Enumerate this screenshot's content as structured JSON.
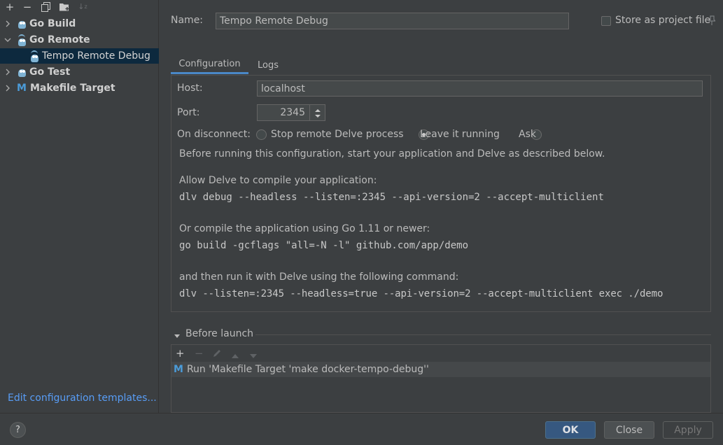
{
  "toolbar": {
    "icons": [
      "add-icon",
      "remove-icon",
      "copy-icon",
      "folder-add-icon",
      "sort-icon"
    ]
  },
  "tree": {
    "items": [
      {
        "label": "Go Build",
        "icon": "go-gopher-icon",
        "expanded": false
      },
      {
        "label": "Go Remote",
        "icon": "go-remote-icon",
        "expanded": true
      },
      {
        "label": "Tempo Remote Debug",
        "icon": "go-remote-icon",
        "selected": true
      },
      {
        "label": "Go Test",
        "icon": "go-gopher-icon",
        "expanded": false
      },
      {
        "label": "Makefile Target",
        "icon": "makefile-icon",
        "expanded": false
      }
    ]
  },
  "edit_templates_link": "Edit configuration templates...",
  "form": {
    "name_label": "Name:",
    "name_value": "Tempo Remote Debug",
    "store_label": "Store as project file",
    "tabs": [
      "Configuration",
      "Logs"
    ],
    "host_label": "Host:",
    "host_value": "localhost",
    "port_label": "Port:",
    "port_value": "2345",
    "disconnect_label": "On disconnect:",
    "disconnect_options": [
      "Stop remote Delve process",
      "Leave it running",
      "Ask"
    ],
    "disconnect_selected": "Leave it running"
  },
  "instructions": {
    "intro": "Before running this configuration, start your application and Delve as described below.",
    "step1_text": "Allow Delve to compile your application:",
    "step1_cmd": "dlv debug --headless --listen=:2345 --api-version=2 --accept-multiclient",
    "step2_text": "Or compile the application using Go 1.11 or newer:",
    "step2_cmd": "go build -gcflags \"all=-N -l\" github.com/app/demo",
    "step3_text": "and then run it with Delve using the following command:",
    "step3_cmd": "dlv --listen=:2345 --headless=true --api-version=2 --accept-multiclient exec ./demo"
  },
  "before_launch": {
    "title": "Before launch",
    "item": "Run 'Makefile Target 'make docker-tempo-debug''"
  },
  "buttons": {
    "help": "?",
    "ok": "OK",
    "close": "Close",
    "apply": "Apply"
  },
  "colors": {
    "accent": "#4a88c7",
    "ok_button": "#365880",
    "link": "#589df6",
    "selection": "#0d293e"
  }
}
